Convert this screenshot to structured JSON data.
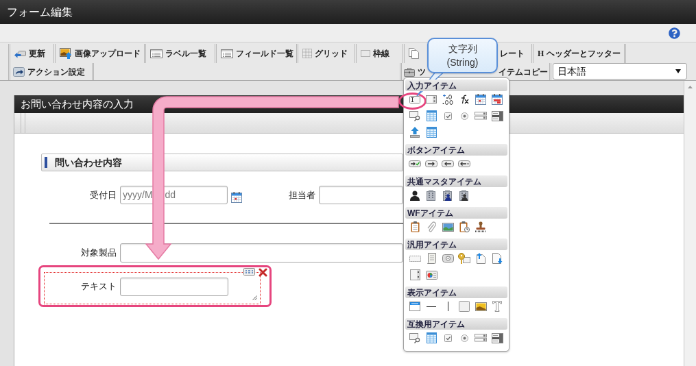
{
  "window": {
    "title": "フォーム編集"
  },
  "toolbar": {
    "row_1": [
      {
        "kind": "refresh",
        "label": "更新"
      },
      {
        "kind": "imageupload",
        "label": "画像アップロード"
      },
      {
        "kind": "list",
        "label": "ラベル一覧"
      },
      {
        "kind": "list",
        "label": "フィールド一覧"
      },
      {
        "kind": "grid",
        "label": "グリッド"
      },
      {
        "kind": "frame",
        "label": "枠線"
      },
      {
        "kind": "copy",
        "label": "レート"
      },
      {
        "kind": "letter",
        "icon_text": "H",
        "label": "ヘッダーとフッター"
      }
    ],
    "row_2_left": [
      {
        "kind": "action",
        "label": "アクション設定"
      }
    ],
    "row_2_right": [
      {
        "kind": "toolbox",
        "label": "ツ"
      },
      {
        "kind": "none",
        "label": "イテムコピー"
      }
    ],
    "language_select": {
      "value": "日本語"
    }
  },
  "callout": {
    "lines": [
      "文字列",
      "(String)"
    ]
  },
  "form": {
    "title": "お問い合わせ内容の入力",
    "section_heading": "問い合わせ内容",
    "date_field": {
      "label": "受付日",
      "placeholder_visible": [
        "yyyy/M",
        "dd"
      ]
    },
    "person_field": {
      "label": "担当者"
    },
    "product_field": {
      "label": "対象製品"
    },
    "text_item": {
      "label": "テキスト",
      "selected": true,
      "highlighted": true
    }
  },
  "palette": {
    "sections": [
      {
        "title": "入力アイテム",
        "items": [
          {
            "kind": "textbox",
            "highlighted": true
          },
          {
            "kind": "textarea",
            "highlighted": false
          },
          {
            "kind": "decimal",
            "highlighted": false
          },
          {
            "kind": "formula",
            "highlighted": false
          },
          {
            "kind": "date",
            "highlighted": false
          },
          {
            "kind": "datetime",
            "highlighted": false
          },
          {
            "kind": "lookup",
            "highlighted": false
          },
          {
            "kind": "grid",
            "highlighted": false
          },
          {
            "kind": "checkbox",
            "highlighted": false
          },
          {
            "kind": "radio",
            "highlighted": false
          },
          {
            "kind": "list",
            "highlighted": false
          },
          {
            "kind": "select",
            "highlighted": false
          },
          {
            "kind": "upload",
            "highlighted": false
          },
          {
            "kind": "grid",
            "highlighted": false
          }
        ]
      },
      {
        "title": "ボタンアイテム",
        "items": [
          {
            "kind": "submit",
            "highlighted": false
          },
          {
            "kind": "forward",
            "highlighted": false
          },
          {
            "kind": "back",
            "highlighted": false
          },
          {
            "kind": "backmore",
            "highlighted": false
          }
        ]
      },
      {
        "title": "共通マスタアイテム",
        "items": [
          {
            "kind": "user",
            "highlighted": false
          },
          {
            "kind": "building",
            "highlighted": false
          },
          {
            "kind": "orguser",
            "highlighted": false
          },
          {
            "kind": "orgbuilding",
            "highlighted": false
          }
        ]
      },
      {
        "title": "WFアイテム",
        "items": [
          {
            "kind": "clipboard",
            "highlighted": false
          },
          {
            "kind": "paperclip",
            "highlighted": false
          },
          {
            "kind": "image",
            "highlighted": false
          },
          {
            "kind": "clipboardclock",
            "highlighted": false
          },
          {
            "kind": "stamp",
            "highlighted": false
          }
        ]
      },
      {
        "title": "汎用アイテム",
        "items": [
          {
            "kind": "dashedbox",
            "highlighted": false
          },
          {
            "kind": "scroll",
            "highlighted": false
          },
          {
            "kind": "camera",
            "highlighted": false
          },
          {
            "kind": "key",
            "highlighted": false
          },
          {
            "kind": "fileup",
            "highlighted": false
          },
          {
            "kind": "filedown",
            "highlighted": false
          },
          {
            "kind": "panel",
            "highlighted": false
          },
          {
            "kind": "chart",
            "highlighted": false
          }
        ]
      },
      {
        "title": "表示アイテム",
        "items": [
          {
            "kind": "header",
            "highlighted": false
          },
          {
            "kind": "hline",
            "highlighted": false
          },
          {
            "kind": "vline",
            "highlighted": false
          },
          {
            "kind": "blank",
            "highlighted": false
          },
          {
            "kind": "picture",
            "highlighted": false
          },
          {
            "kind": "text",
            "highlighted": false
          }
        ]
      },
      {
        "title": "互換用アイテム",
        "items": [
          {
            "kind": "lookup",
            "highlighted": false
          },
          {
            "kind": "grid",
            "highlighted": false
          },
          {
            "kind": "checkbox",
            "highlighted": false
          },
          {
            "kind": "radio",
            "highlighted": false
          },
          {
            "kind": "list",
            "highlighted": false
          },
          {
            "kind": "select",
            "highlighted": false
          }
        ]
      }
    ]
  }
}
